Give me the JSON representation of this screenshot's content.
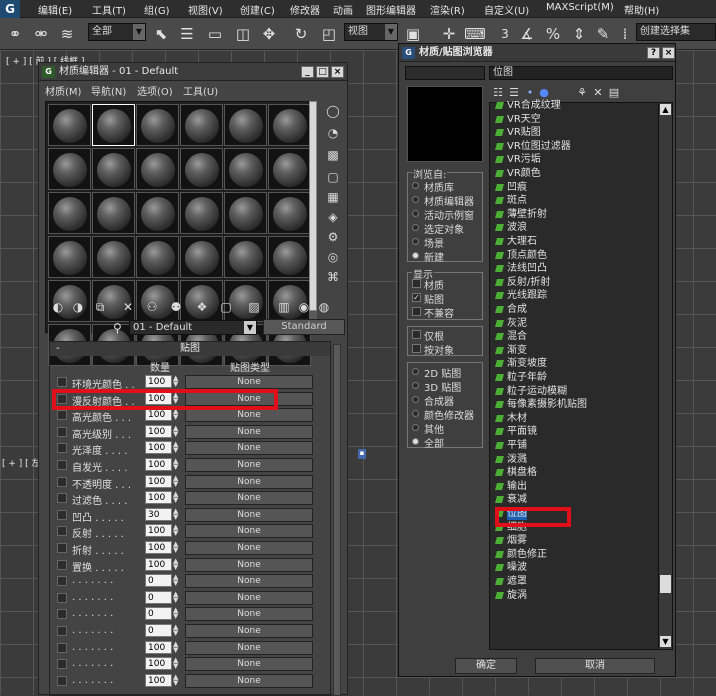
{
  "menu": {
    "items": [
      "编辑(E)",
      "工具(T)",
      "组(G)",
      "视图(V)",
      "创建(C)",
      "修改器",
      "动画",
      "图形编辑器",
      "渲染(R)",
      "自定义(U)",
      "MAXScript(M)",
      "帮助(H)"
    ]
  },
  "toolbar": {
    "selection_filter": "全部",
    "ref_coord": "视图",
    "named_selection": "创建选择集",
    "snap_value": "3"
  },
  "viewport": {
    "top_label": "[ + ] [ 前 ] [ 线框 ]",
    "left_label": "[ + ] [ 左"
  },
  "material_editor": {
    "title": "材质编辑器 - 01 - Default",
    "menus": [
      "材质(M)",
      "导航(N)",
      "选项(O)",
      "工具(U)"
    ],
    "material_name": "01 - Default",
    "material_type": "Standard",
    "maps_rollout_title": "贴图",
    "col_amount": "数量",
    "col_map_type": "贴图类型",
    "map_rows": [
      {
        "label": "环境光颜色 . .",
        "amount": "100",
        "map": "None"
      },
      {
        "label": "漫反射颜色 . .",
        "amount": "100",
        "map": "None"
      },
      {
        "label": "高光颜色 . . .",
        "amount": "100",
        "map": "None"
      },
      {
        "label": "高光级别 . . .",
        "amount": "100",
        "map": "None"
      },
      {
        "label": "光泽度 . . . .",
        "amount": "100",
        "map": "None"
      },
      {
        "label": "自发光 . . . .",
        "amount": "100",
        "map": "None"
      },
      {
        "label": "不透明度 . . .",
        "amount": "100",
        "map": "None"
      },
      {
        "label": "过滤色 . . . .",
        "amount": "100",
        "map": "None"
      },
      {
        "label": "凹凸 . . . . .",
        "amount": "30",
        "map": "None"
      },
      {
        "label": "反射 . . . . .",
        "amount": "100",
        "map": "None"
      },
      {
        "label": "折射 . . . . .",
        "amount": "100",
        "map": "None"
      },
      {
        "label": "置换 . . . . .",
        "amount": "100",
        "map": "None"
      },
      {
        "label": ". . . . . . .",
        "amount": "0",
        "map": "None"
      },
      {
        "label": ". . . . . . .",
        "amount": "0",
        "map": "None"
      },
      {
        "label": ". . . . . . .",
        "amount": "0",
        "map": "None"
      },
      {
        "label": ". . . . . . .",
        "amount": "0",
        "map": "None"
      },
      {
        "label": ". . . . . . .",
        "amount": "100",
        "map": "None"
      },
      {
        "label": ". . . . . . .",
        "amount": "100",
        "map": "None"
      },
      {
        "label": ". . . . . . .",
        "amount": "100",
        "map": "None"
      }
    ]
  },
  "map_browser": {
    "title": "材质/贴图浏览器",
    "path": "位图",
    "browse_from_title": "浏览自:",
    "browse_from": [
      {
        "label": "材质库",
        "on": false
      },
      {
        "label": "材质编辑器",
        "on": false
      },
      {
        "label": "活动示例窗",
        "on": false
      },
      {
        "label": "选定对象",
        "on": false
      },
      {
        "label": "场景",
        "on": false
      },
      {
        "label": "新建",
        "on": true
      }
    ],
    "show_title": "显示",
    "show": [
      {
        "label": "材质",
        "checked": false
      },
      {
        "label": "贴图",
        "checked": true
      },
      {
        "label": "不兼容",
        "checked": false
      }
    ],
    "extra": [
      {
        "label": "仅根",
        "checked": false
      },
      {
        "label": "按对象",
        "checked": false
      }
    ],
    "map_types": [
      {
        "label": "2D 贴图",
        "on": false
      },
      {
        "label": "3D 贴图",
        "on": false
      },
      {
        "label": "合成器",
        "on": false
      },
      {
        "label": "颜色修改器",
        "on": false
      },
      {
        "label": "其他",
        "on": false
      },
      {
        "label": "全部",
        "on": true
      }
    ],
    "list": [
      "VR合成纹理",
      "VR天空",
      "VR贴图",
      "VR位图过滤器",
      "VR污垢",
      "VR颜色",
      "凹痕",
      "斑点",
      "薄壁折射",
      "波浪",
      "大理石",
      "顶点颜色",
      "法线凹凸",
      "反射/折射",
      "光线跟踪",
      "合成",
      "灰泥",
      "混合",
      "渐变",
      "渐变坡度",
      "粒子年龄",
      "粒子运动模糊",
      "每像素摄影机贴图",
      "木材",
      "平面镜",
      "平铺",
      "泼溅",
      "棋盘格",
      "输出",
      "衰减",
      "位图",
      "细胞",
      "烟雾",
      "颜色修正",
      "噪波",
      "遮罩",
      "旋涡"
    ],
    "ok_label": "确定",
    "cancel_label": "取消"
  },
  "highlight_color": "#e0101b"
}
